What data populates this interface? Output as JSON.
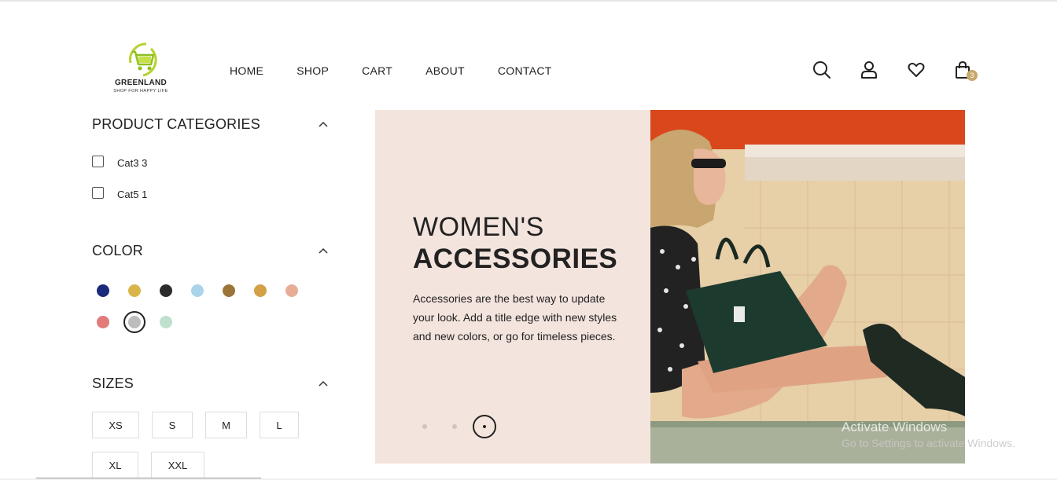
{
  "logo": {
    "brand": "GREENLAND",
    "tagline": "SHOP FOR HAPPY LIFE"
  },
  "nav": [
    "HOME",
    "SHOP",
    "CART",
    "ABOUT",
    "CONTACT"
  ],
  "header_icons": {
    "search": "search-icon",
    "account": "user-icon",
    "wishlist": "heart-icon",
    "cart": "bag-icon",
    "cart_count": "3"
  },
  "sidebar": {
    "categories": {
      "title": "PRODUCT CATEGORIES",
      "items": [
        {
          "label": "Cat3 3",
          "checked": false
        },
        {
          "label": "Cat5 1",
          "checked": false
        }
      ]
    },
    "color": {
      "title": "COLOR",
      "swatches": [
        "#1a2a7a",
        "#d9b54a",
        "#2b2b2b",
        "#a9d4ea",
        "#9c7438",
        "#d4a045",
        "#e8ad98",
        "#e27a7a",
        "#bdbdbd",
        "#bfe0cc"
      ],
      "selected_index": 8
    },
    "sizes": {
      "title": "SIZES",
      "items": [
        "XS",
        "S",
        "M",
        "L",
        "XL",
        "XXL"
      ]
    }
  },
  "hero": {
    "title_line1": "WOMEN'S",
    "title_line2": "ACCESSORIES",
    "description": "Accessories are the best way to update your look. Add a title edge with new styles and new colors, or go for timeless pieces.",
    "slides": 3,
    "active_slide": 3
  },
  "watermark": {
    "line1": "Activate Windows",
    "line2": "Go to Settings to activate Windows."
  }
}
